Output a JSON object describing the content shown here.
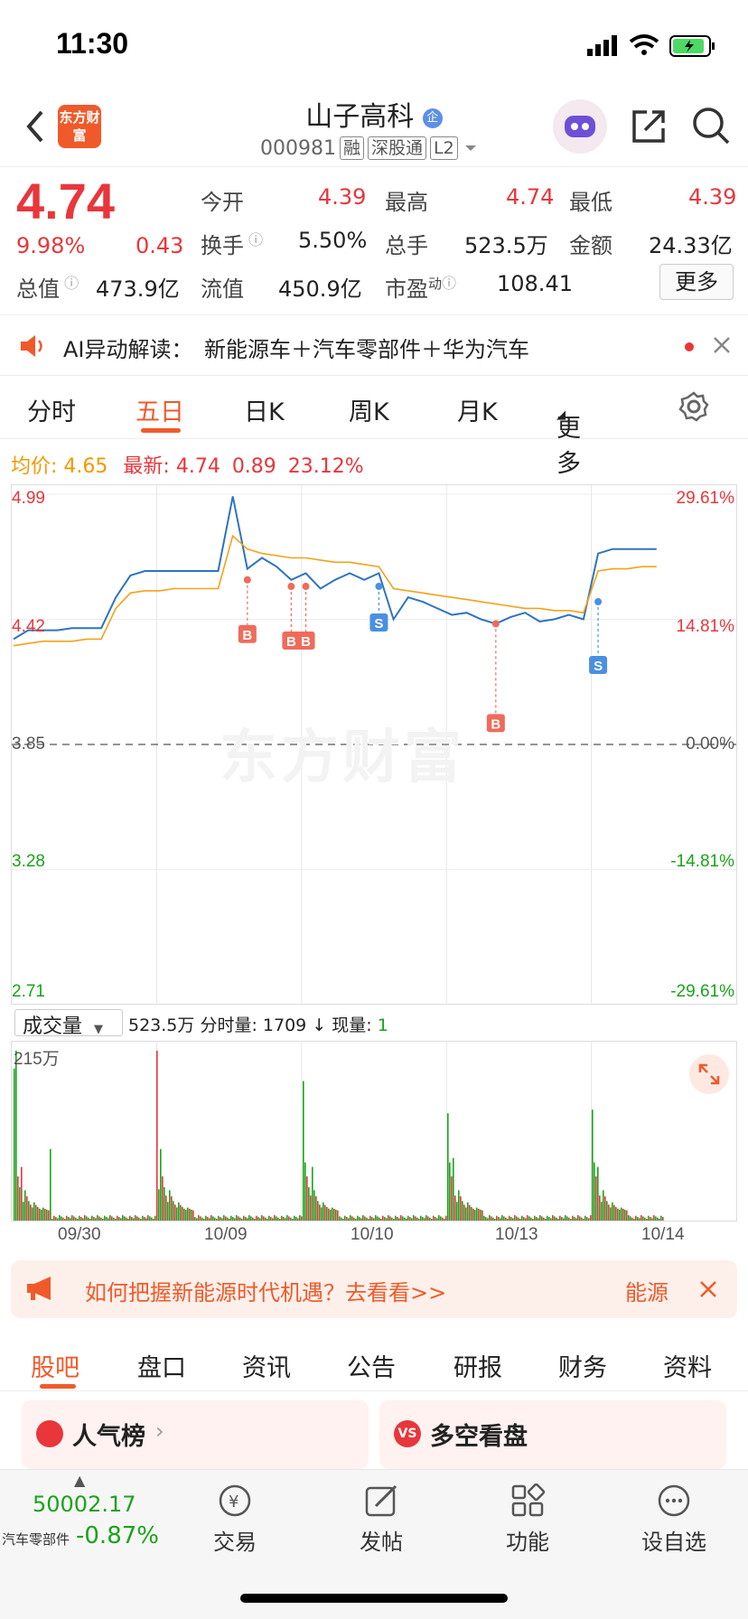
{
  "status_bar": {
    "time": "11:30"
  },
  "header": {
    "logo_text": "东方财富",
    "title": "山子高科",
    "badge": "企",
    "code": "000981",
    "tags": [
      "融",
      "深股通",
      "L2"
    ]
  },
  "quote": {
    "price": "4.74",
    "change_pct": "9.98%",
    "change": "0.43",
    "open_label": "今开",
    "open": "4.39",
    "high_label": "最高",
    "high": "4.74",
    "low_label": "最低",
    "low": "4.39",
    "turnover_label": "换手",
    "turnover": "5.50%",
    "volume_label": "总手",
    "volume": "523.5万",
    "amount_label": "金额",
    "amount": "24.33亿",
    "mktcap_label": "总值",
    "mktcap": "473.9亿",
    "float_label": "流值",
    "float_value": "450.9亿",
    "pe_label": "市盈",
    "pe_sup": "动",
    "pe": "108.41",
    "more_label": "更多"
  },
  "ai_bar": {
    "label": "AI异动解读：",
    "text": "新能源车＋汽车零部件＋华为汽车"
  },
  "tabs": [
    "分时",
    "五日",
    "日K",
    "周K",
    "月K",
    "更多"
  ],
  "info_line": {
    "avg_label": "均价:",
    "avg": "4.65",
    "latest_label": "最新:",
    "latest": "4.74",
    "chg": "0.89",
    "chg_pct": "23.12%"
  },
  "chart_data": {
    "type": "line",
    "y_left_ticks": [
      "4.99",
      "4.42",
      "3.85",
      "3.28",
      "2.71"
    ],
    "y_right_ticks": [
      "29.61%",
      "14.81%",
      "0.00%",
      "-14.81%",
      "-29.61%"
    ],
    "ylim": [
      2.71,
      4.99
    ],
    "base": 3.85,
    "x_labels": [
      "09/30",
      "10/09",
      "10/10",
      "10/13",
      "10/14"
    ],
    "series": [
      {
        "values": [
          4.33,
          4.37,
          4.37,
          4.37,
          4.38,
          4.38,
          4.38,
          4.52,
          4.62,
          4.64,
          4.64,
          4.64,
          4.64,
          4.64,
          4.64,
          4.98,
          4.65,
          4.7,
          4.66,
          4.6,
          4.63,
          4.56,
          4.6,
          4.63,
          4.6,
          4.63,
          4.42,
          4.52,
          4.5,
          4.47,
          4.44,
          4.45,
          4.42,
          4.4,
          4.43,
          4.45,
          4.41,
          4.42,
          4.44,
          4.42,
          4.72,
          4.74,
          4.74,
          4.74,
          4.74
        ],
        "color": "#2f74c0"
      },
      {
        "values": [
          4.3,
          4.31,
          4.32,
          4.32,
          4.32,
          4.33,
          4.33,
          4.47,
          4.54,
          4.55,
          4.55,
          4.56,
          4.56,
          4.56,
          4.56,
          4.8,
          4.74,
          4.72,
          4.71,
          4.7,
          4.7,
          4.69,
          4.68,
          4.68,
          4.67,
          4.66,
          4.56,
          4.55,
          4.54,
          4.53,
          4.52,
          4.51,
          4.5,
          4.49,
          4.48,
          4.47,
          4.47,
          4.46,
          4.46,
          4.45,
          4.64,
          4.65,
          4.65,
          4.66,
          4.66
        ],
        "color": "#f3a21b"
      }
    ],
    "markers": [
      {
        "label": "B",
        "type": "buy",
        "x": 16,
        "y": 4.6
      },
      {
        "label": "B",
        "type": "buy",
        "x": 19,
        "y": 4.57
      },
      {
        "label": "B",
        "type": "buy",
        "x": 20,
        "y": 4.57
      },
      {
        "label": "S",
        "type": "sell",
        "x": 25,
        "y": 4.57
      },
      {
        "label": "B",
        "type": "buy",
        "x": 33,
        "y": 4.4
      },
      {
        "label": "S",
        "type": "sell",
        "x": 40,
        "y": 4.5
      }
    ]
  },
  "volume": {
    "selector": "成交量",
    "summary": "523.5万",
    "tick_label": "分时量:",
    "tick_value": "1709",
    "current_label": "现量:",
    "current_value": "1",
    "max_label": "215万"
  },
  "promo": {
    "text": "如何把握新能源时代机遇？去看看>>",
    "tail": "能源"
  },
  "bottom_tabs": [
    "股吧",
    "盘口",
    "资讯",
    "公告",
    "研报",
    "财务",
    "资料"
  ],
  "cards": [
    {
      "title": "人气榜"
    },
    {
      "title": "多空看盘"
    }
  ],
  "bottom_nav": {
    "index_value": "50002.17",
    "index_name": "汽车零部件",
    "index_change": "-0.87%",
    "items": [
      "交易",
      "发帖",
      "功能",
      "设自选"
    ]
  },
  "colors": {
    "up": "#e8363b",
    "down": "#1aa31a",
    "accent": "#f05a2a",
    "price_line": "#2f74c0",
    "avg_line": "#f3a21b"
  }
}
